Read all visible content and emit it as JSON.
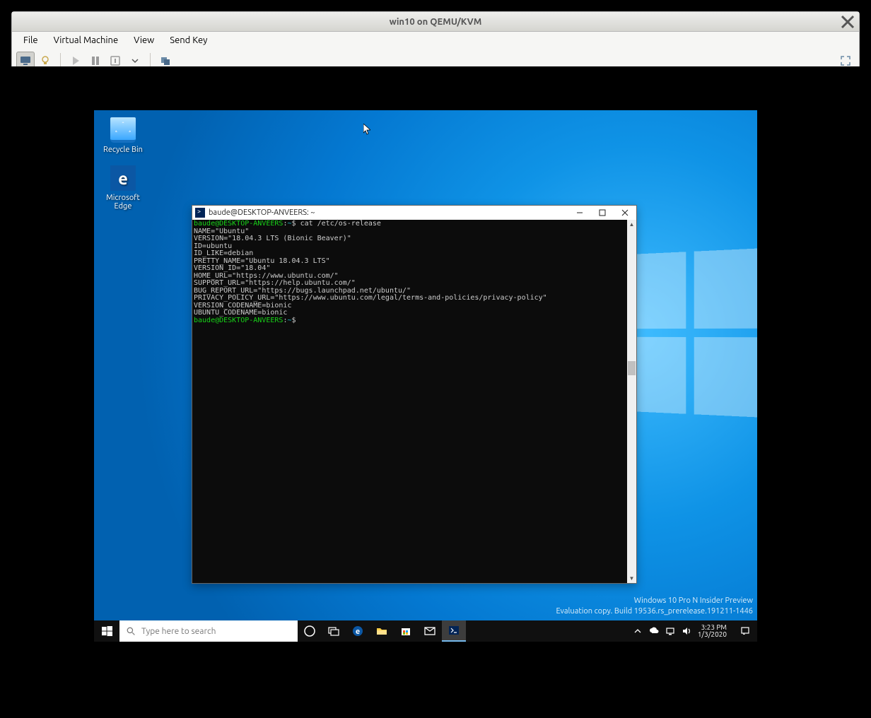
{
  "virtmgr": {
    "title": "win10 on QEMU/KVM",
    "menu": {
      "file": "File",
      "vm": "Virtual Machine",
      "view": "View",
      "sendkey": "Send Key"
    }
  },
  "desktop_icons": {
    "recycle": "Recycle Bin",
    "edge": "Microsoft Edge"
  },
  "watermark": {
    "line1": "Windows 10 Pro N Insider Preview",
    "line2": "Evaluation copy. Build 19536.rs_prerelease.191211-1446"
  },
  "taskbar": {
    "search_placeholder": "Type here to search",
    "time": "3:23 PM",
    "date": "1/3/2020"
  },
  "terminal": {
    "title": "baude@DESKTOP-ANVEERS: ~",
    "prompt_user": "baude@DESKTOP-ANVEERS",
    "prompt_colon": ":",
    "prompt_tilde": "~",
    "prompt_dollar": "$",
    "cmd": "cat /etc/os-release",
    "output": "NAME=\"Ubuntu\"\nVERSION=\"18.04.3 LTS (Bionic Beaver)\"\nID=ubuntu\nID_LIKE=debian\nPRETTY_NAME=\"Ubuntu 18.04.3 LTS\"\nVERSION_ID=\"18.04\"\nHOME_URL=\"https://www.ubuntu.com/\"\nSUPPORT_URL=\"https://help.ubuntu.com/\"\nBUG_REPORT_URL=\"https://bugs.launchpad.net/ubuntu/\"\nPRIVACY_POLICY_URL=\"https://www.ubuntu.com/legal/terms-and-policies/privacy-policy\"\nVERSION_CODENAME=bionic\nUBUNTU_CODENAME=bionic"
  }
}
